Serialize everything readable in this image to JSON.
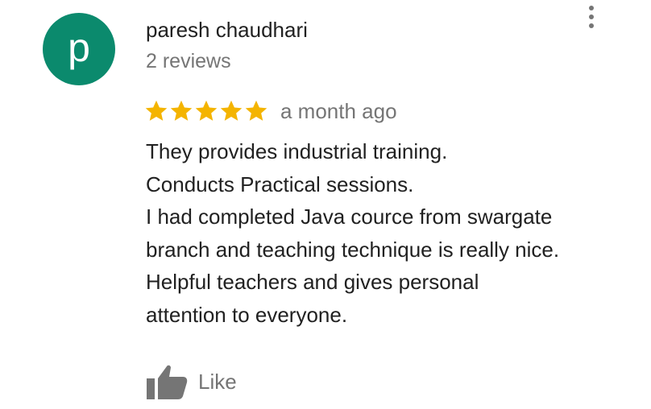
{
  "review": {
    "avatar_letter": "p",
    "author_name": "paresh chaudhari",
    "review_count": "2 reviews",
    "rating": 5,
    "rating_max": 5,
    "date": "a month ago",
    "text_lines": [
      "They provides industrial training.",
      "Conducts Practical sessions.",
      "I had completed Java cource from swargate",
      "branch and teaching technique is really nice.",
      "Helpful teachers and gives personal",
      "attention to everyone."
    ],
    "like_label": "Like"
  },
  "icons": {
    "more": "more-vertical-icon",
    "star": "star-icon",
    "like": "thumbs-up-icon"
  },
  "colors": {
    "avatar_bg": "#0b8a6d",
    "star": "#f4b400",
    "primary_text": "#212121",
    "secondary_text": "#757575",
    "icon_gray": "#757575"
  }
}
